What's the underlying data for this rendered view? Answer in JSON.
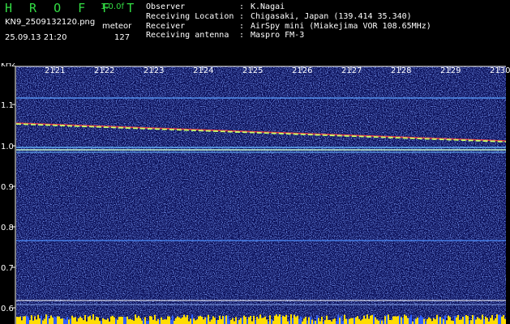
{
  "header": {
    "app_title": "H R O F F T",
    "version": "1.0.0f",
    "file_name": "KN9_2509132120.png",
    "mode": "meteor",
    "datetime": "25.09.13 21:20",
    "count": "127",
    "info_rows": [
      {
        "key": "Observer",
        "value": "K.Nagai"
      },
      {
        "key": "Receiving Location",
        "value": "Chigasaki, Japan (139.414 35.340)"
      },
      {
        "key": "Receiver",
        "value": "AirSpy mini (Miakejima VOR 108.65MHz)"
      },
      {
        "key": "Receiving antenna",
        "value": "Maspro FM-3"
      }
    ]
  },
  "spectrogram": {
    "y_unit": "kHz",
    "y_ticks": [
      "1.1",
      "1.0",
      "0.9",
      "0.8",
      "0.7",
      "0.6"
    ],
    "x_ticks": [
      "2121",
      "2122",
      "2123",
      "2124",
      "2125",
      "2126",
      "2127",
      "2128",
      "2129",
      "2130"
    ],
    "colors": {
      "background": "#060a52",
      "noise": "#3a5cff",
      "axis": "#ffffff",
      "trace": "#c8ff6a",
      "trace_alt": "#ff4040",
      "bar": "#ffdd00"
    }
  }
}
